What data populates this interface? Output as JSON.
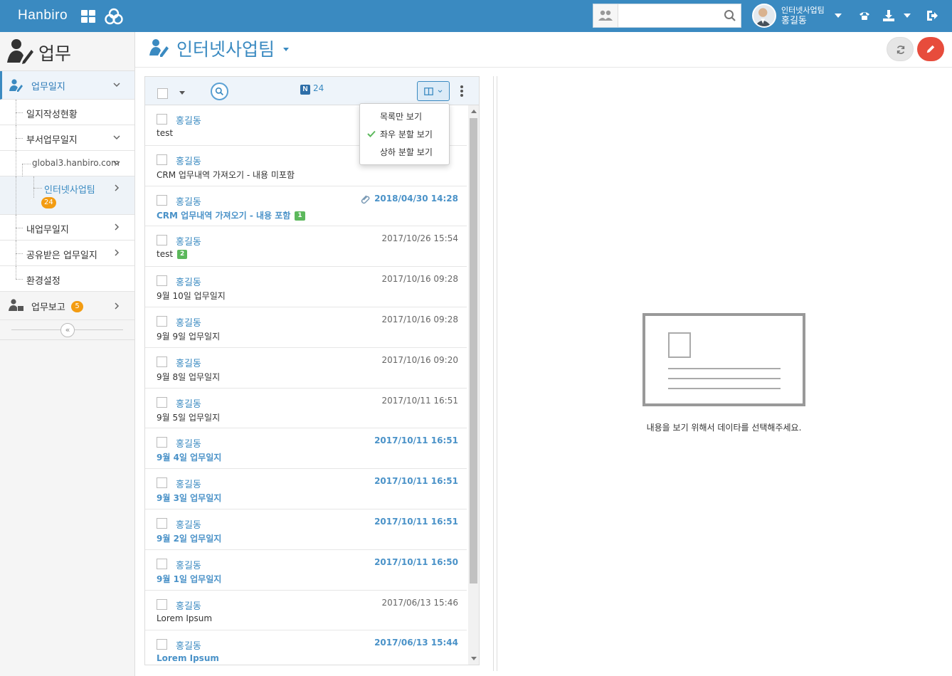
{
  "topbar": {
    "brand": "Hanbiro",
    "search": {
      "value": "",
      "placeholder": ""
    },
    "user": {
      "team": "인터넷사업팀",
      "name": "홍길동"
    },
    "icons": [
      "apps-grid-icon",
      "hanbiro-logo-icon",
      "org-chart-icon",
      "search-icon",
      "phone-icon",
      "download-icon",
      "logout-icon"
    ]
  },
  "sidebar": {
    "title": "업무",
    "items": [
      {
        "label": "업무일지"
      },
      {
        "label": "일지작성현황"
      },
      {
        "label": "부서업무일지"
      },
      {
        "label": "global3.hanbiro.com"
      },
      {
        "label": "인터넷사업팀",
        "badge": "24"
      },
      {
        "label": "내업무일지"
      },
      {
        "label": "공유받은 업무일지"
      },
      {
        "label": "환경설정"
      },
      {
        "label": "업무보고",
        "badge": "5"
      }
    ]
  },
  "page": {
    "title": "인터넷사업팀"
  },
  "list": {
    "count": "24",
    "n_label": "N",
    "view_menu": [
      {
        "label": "목록만 보기",
        "checked": false
      },
      {
        "label": "좌우 분할 보기",
        "checked": true
      },
      {
        "label": "상하 분할 보기",
        "checked": false
      }
    ],
    "rows": [
      {
        "author": "홍길동",
        "date": "",
        "subject": "test",
        "comments": "",
        "unread": false,
        "attach": false
      },
      {
        "author": "홍길동",
        "date": "",
        "subject": "CRM 업무내역 가져오기 - 내용 미포함",
        "comments": "",
        "unread": false,
        "attach": false
      },
      {
        "author": "홍길동",
        "date": "2018/04/30 14:28",
        "subject": "CRM 업무내역 가져오기 - 내용 포함",
        "comments": "1",
        "unread": true,
        "attach": true
      },
      {
        "author": "홍길동",
        "date": "2017/10/26 15:54",
        "subject": "test",
        "comments": "2",
        "unread": false,
        "attach": false
      },
      {
        "author": "홍길동",
        "date": "2017/10/16 09:28",
        "subject": "9월 10일 업무일지",
        "comments": "",
        "unread": false,
        "attach": false
      },
      {
        "author": "홍길동",
        "date": "2017/10/16 09:28",
        "subject": "9월 9일 업무일지",
        "comments": "",
        "unread": false,
        "attach": false
      },
      {
        "author": "홍길동",
        "date": "2017/10/16 09:20",
        "subject": "9월 8일 업무일지",
        "comments": "",
        "unread": false,
        "attach": false
      },
      {
        "author": "홍길동",
        "date": "2017/10/11 16:51",
        "subject": "9월 5일 업무일지",
        "comments": "",
        "unread": false,
        "attach": false
      },
      {
        "author": "홍길동",
        "date": "2017/10/11 16:51",
        "subject": "9월 4일 업무일지",
        "comments": "",
        "unread": true,
        "attach": false
      },
      {
        "author": "홍길동",
        "date": "2017/10/11 16:51",
        "subject": "9월 3일 업무일지",
        "comments": "",
        "unread": true,
        "attach": false
      },
      {
        "author": "홍길동",
        "date": "2017/10/11 16:51",
        "subject": "9월 2일 업무일지",
        "comments": "",
        "unread": true,
        "attach": false
      },
      {
        "author": "홍길동",
        "date": "2017/10/11 16:50",
        "subject": "9월 1일 업무일지",
        "comments": "",
        "unread": true,
        "attach": false
      },
      {
        "author": "홍길동",
        "date": "2017/06/13 15:46",
        "subject": "Lorem Ipsum",
        "comments": "",
        "unread": false,
        "attach": false
      },
      {
        "author": "홍길동",
        "date": "2017/06/13 15:44",
        "subject": "Lorem Ipsum",
        "comments": "",
        "unread": true,
        "attach": false
      }
    ]
  },
  "detail": {
    "empty_message": "내용을 보기 위해서 데이타를 선택해주세요."
  },
  "colors": {
    "primary": "#3a8ac1",
    "accent_red": "#e74c3c",
    "badge_orange": "#f39c12",
    "comment_green": "#5cb85c"
  }
}
